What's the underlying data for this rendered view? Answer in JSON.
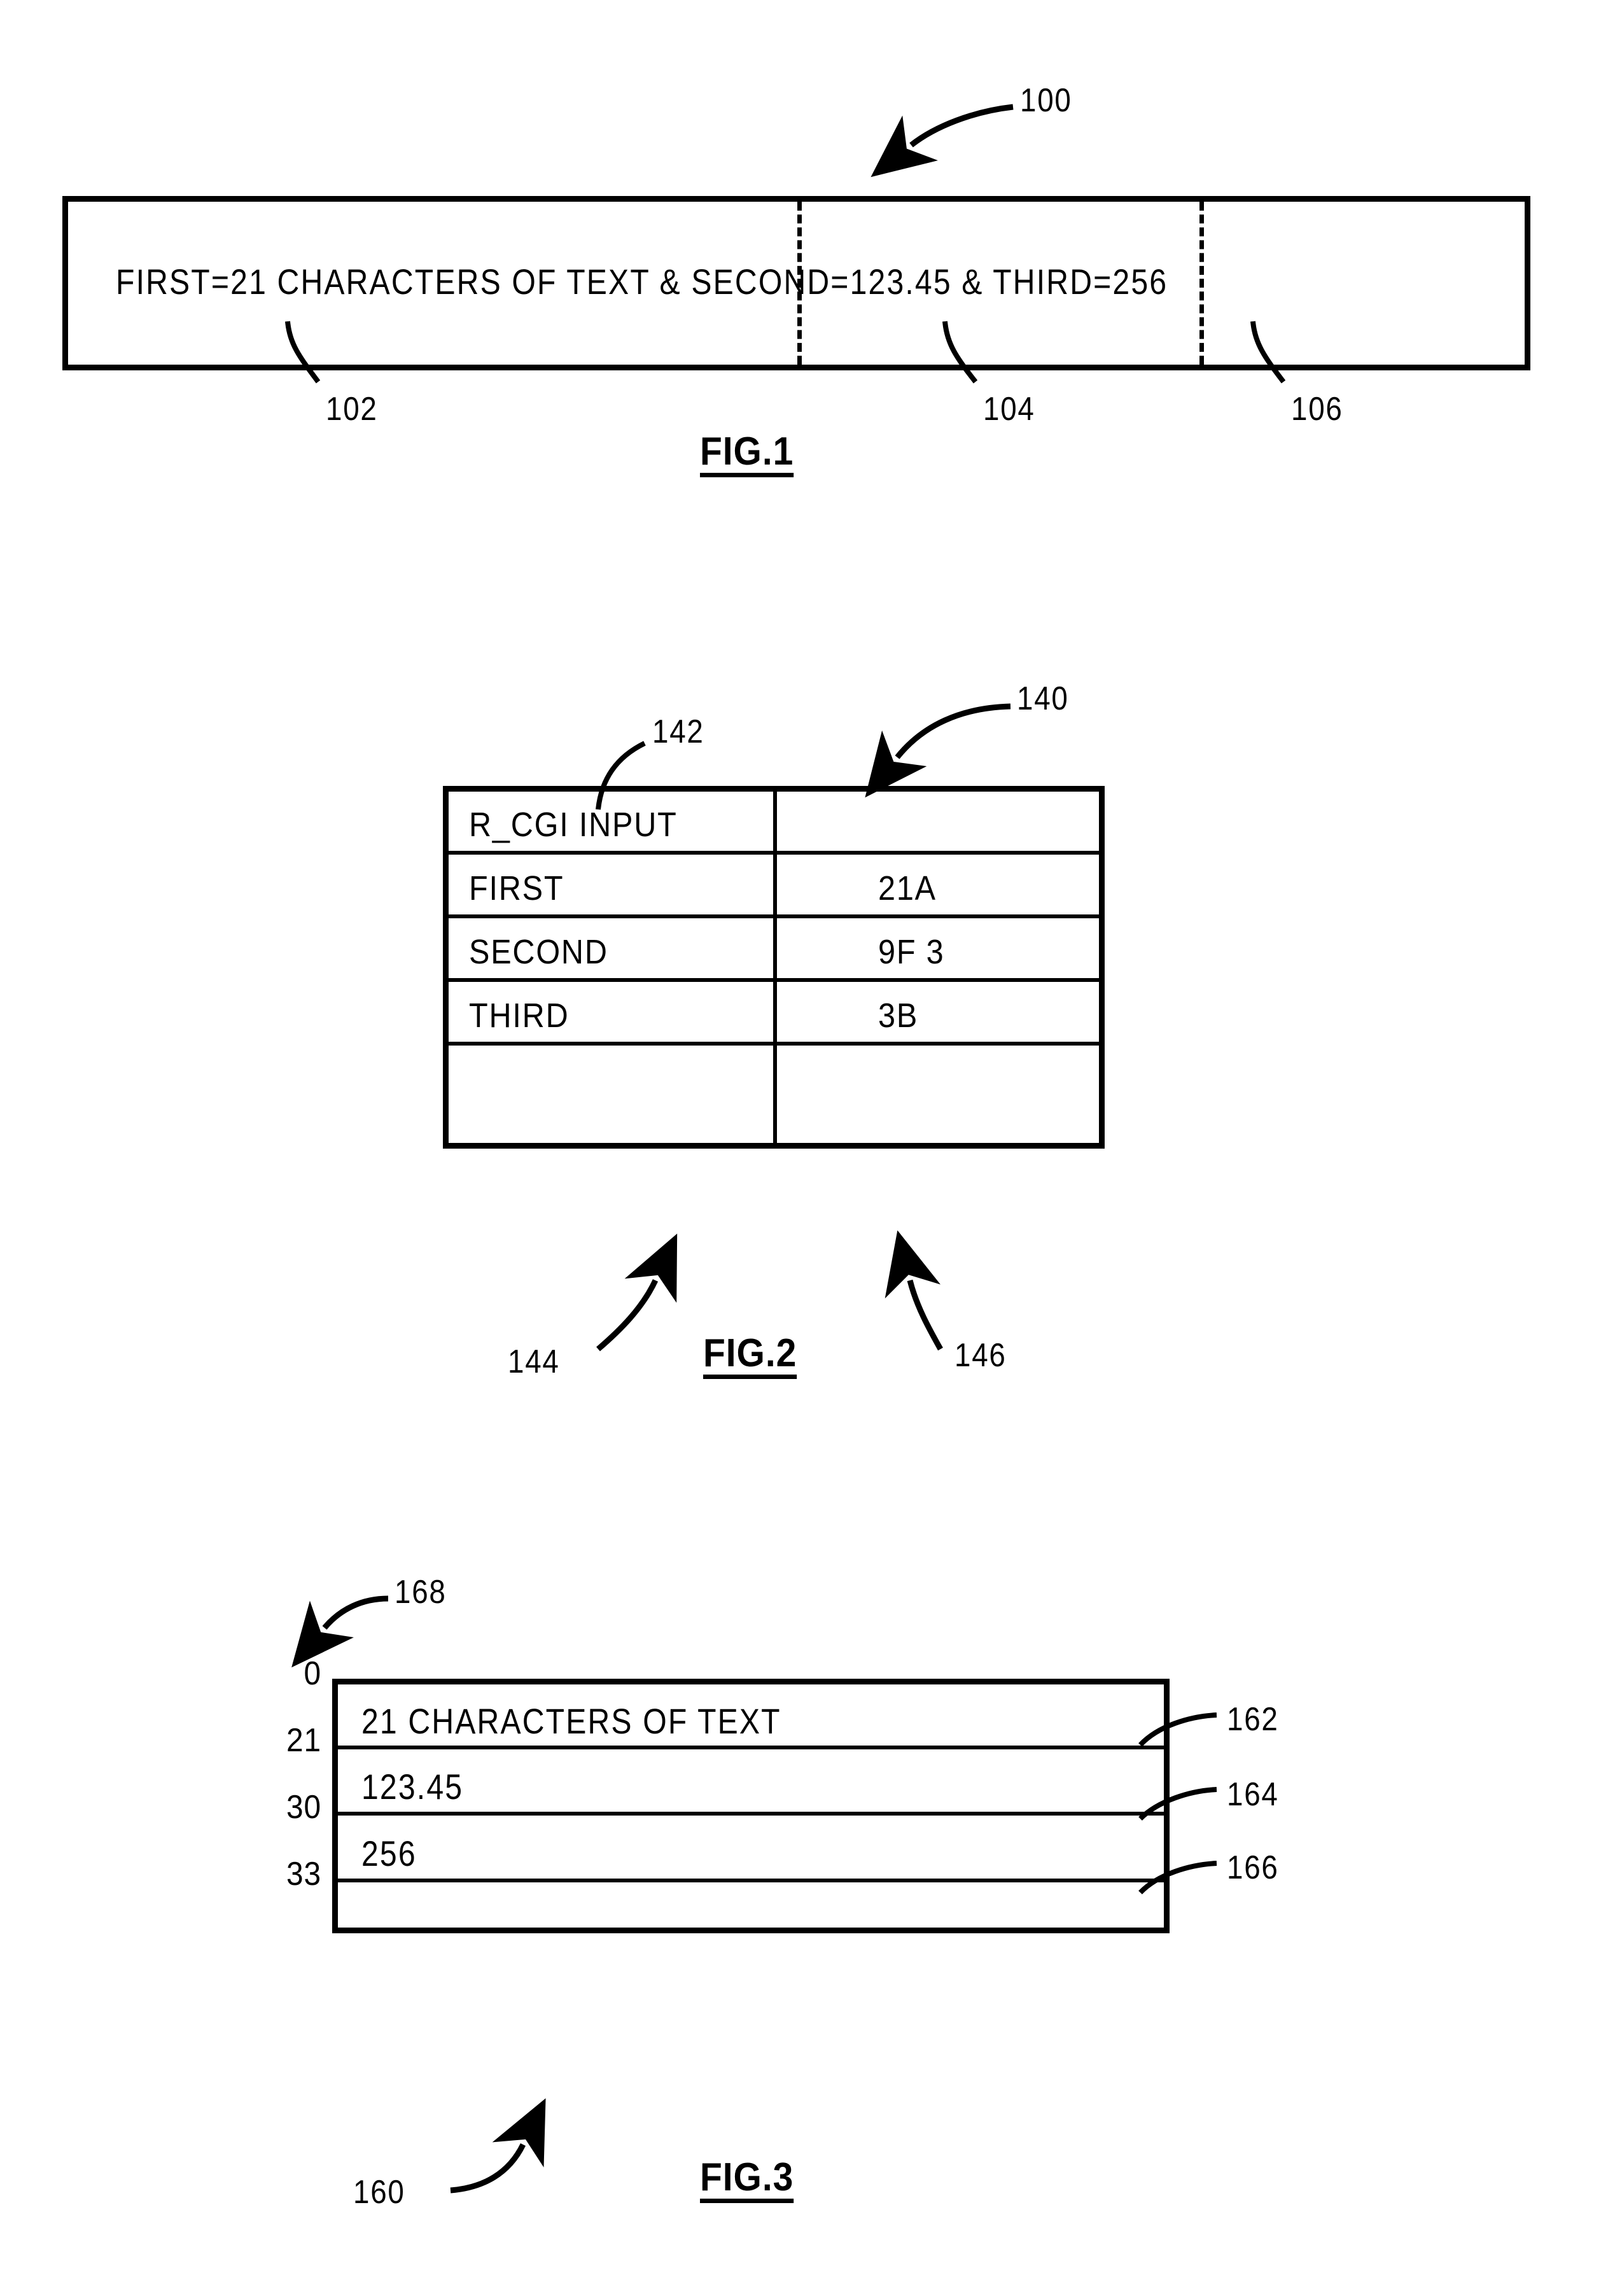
{
  "document": {
    "type": "patent-drawing-sheet",
    "ink_color": "#000000",
    "background_color": "#ffffff"
  },
  "figures": [
    {
      "id": "fig1",
      "caption": "FIG.1",
      "ref_number": "100",
      "content_text": "FIRST=21  CHARACTERS  OF  TEXT  &  SECOND=123.45  &  THIRD=256",
      "segments": [
        {
          "text": "FIRST=21  CHARACTERS  OF  TEXT",
          "ref": "102"
        },
        {
          "text": "SECOND=123.45",
          "ref": "104"
        },
        {
          "text": "THIRD=256",
          "ref": "106"
        }
      ],
      "callouts": [
        "102",
        "104",
        "106"
      ]
    },
    {
      "id": "fig2",
      "caption": "FIG.2",
      "ref_number": "140",
      "header_ref": "142",
      "column_refs": {
        "left": "144",
        "right": "146"
      },
      "rows": [
        {
          "left": "R_CGI INPUT",
          "right": ""
        },
        {
          "left": "FIRST",
          "right": "21A"
        },
        {
          "left": "SECOND",
          "right": "9F 3"
        },
        {
          "left": "THIRD",
          "right": "3B"
        },
        {
          "left": "",
          "right": ""
        }
      ]
    },
    {
      "id": "fig3",
      "caption": "FIG.3",
      "ref_number": "160",
      "axis_ref": "168",
      "offsets": [
        "0",
        "21",
        "30",
        "33"
      ],
      "rows": [
        {
          "text": "21  CHARACTERS  OF  TEXT",
          "ref": "162",
          "start": "0",
          "end": "21"
        },
        {
          "text": "123.45",
          "ref": "164",
          "start": "21",
          "end": "30"
        },
        {
          "text": "256",
          "ref": "166",
          "start": "30",
          "end": "33"
        },
        {
          "text": "",
          "ref": "",
          "start": "33",
          "end": ""
        }
      ]
    }
  ]
}
